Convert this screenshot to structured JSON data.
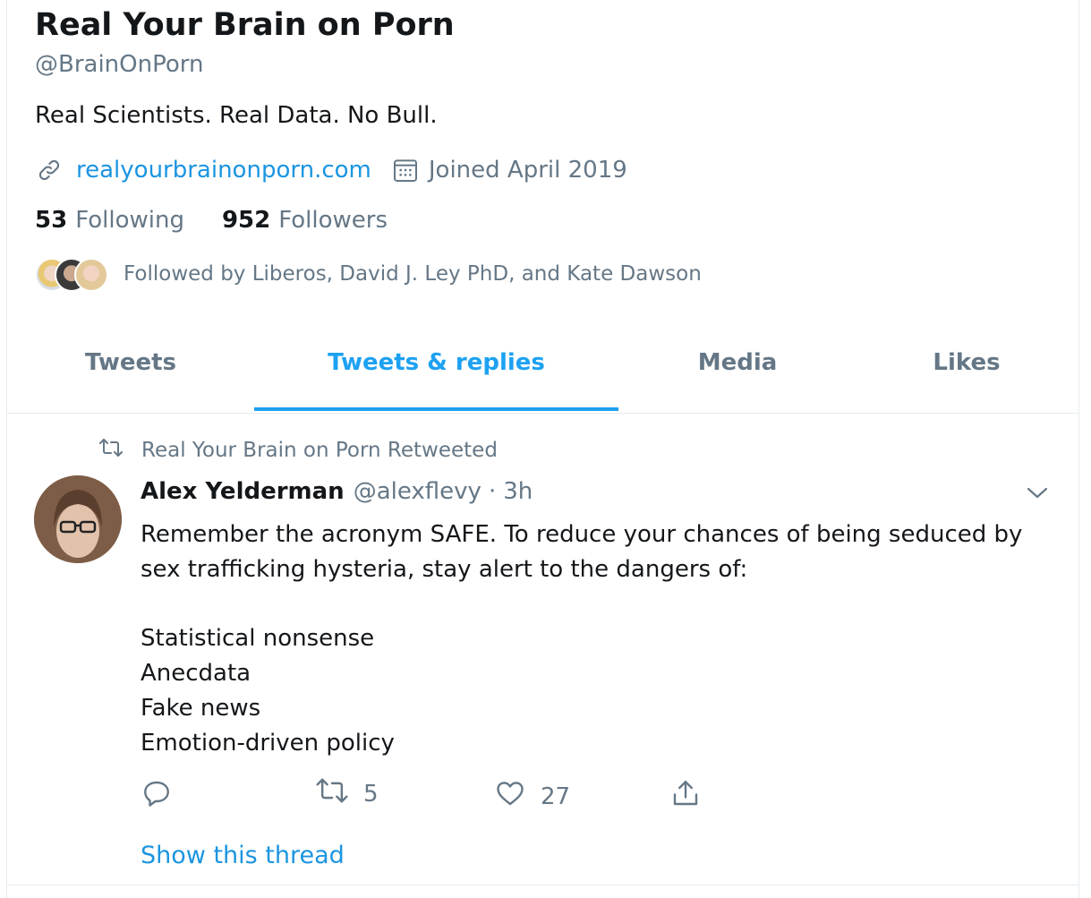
{
  "profile": {
    "display_name": "Real Your Brain on Porn",
    "handle": "@BrainOnPorn",
    "bio": "Real Scientists. Real Data. No Bull.",
    "website": "realyourbrainonporn.com",
    "joined": "Joined April 2019",
    "following_count": "53",
    "following_label": "Following",
    "followers_count": "952",
    "followers_label": "Followers",
    "followed_by": "Followed by Liberos, David J. Ley PhD, and Kate Dawson"
  },
  "tabs": [
    {
      "label": "Tweets",
      "active": false
    },
    {
      "label": "Tweets & replies",
      "active": true
    },
    {
      "label": "Media",
      "active": false
    },
    {
      "label": "Likes",
      "active": false
    }
  ],
  "tweet": {
    "retweet_context": "Real Your Brain on Porn Retweeted",
    "author_name": "Alex Yelderman",
    "author_handle": "@alexflevy",
    "separator": "·",
    "time": "3h",
    "text_lines": [
      "Remember the acronym SAFE. To reduce your chances of being seduced by",
      "sex trafficking hysteria, stay alert to the dangers of:",
      "Statistical nonsense",
      "Anecdata",
      "Fake news",
      "Emotion-driven policy"
    ],
    "retweet_count": "5",
    "like_count": "27",
    "show_thread": "Show this thread"
  },
  "icons": {
    "link": "link-icon",
    "calendar": "calendar-icon",
    "retweet": "retweet-icon",
    "reply": "reply-icon",
    "like": "heart-icon",
    "share": "share-icon",
    "more": "chevron-down-icon"
  },
  "colors": {
    "accent": "#1da1f2",
    "link": "#1b95e0",
    "muted": "#657786",
    "text": "#14171a"
  }
}
